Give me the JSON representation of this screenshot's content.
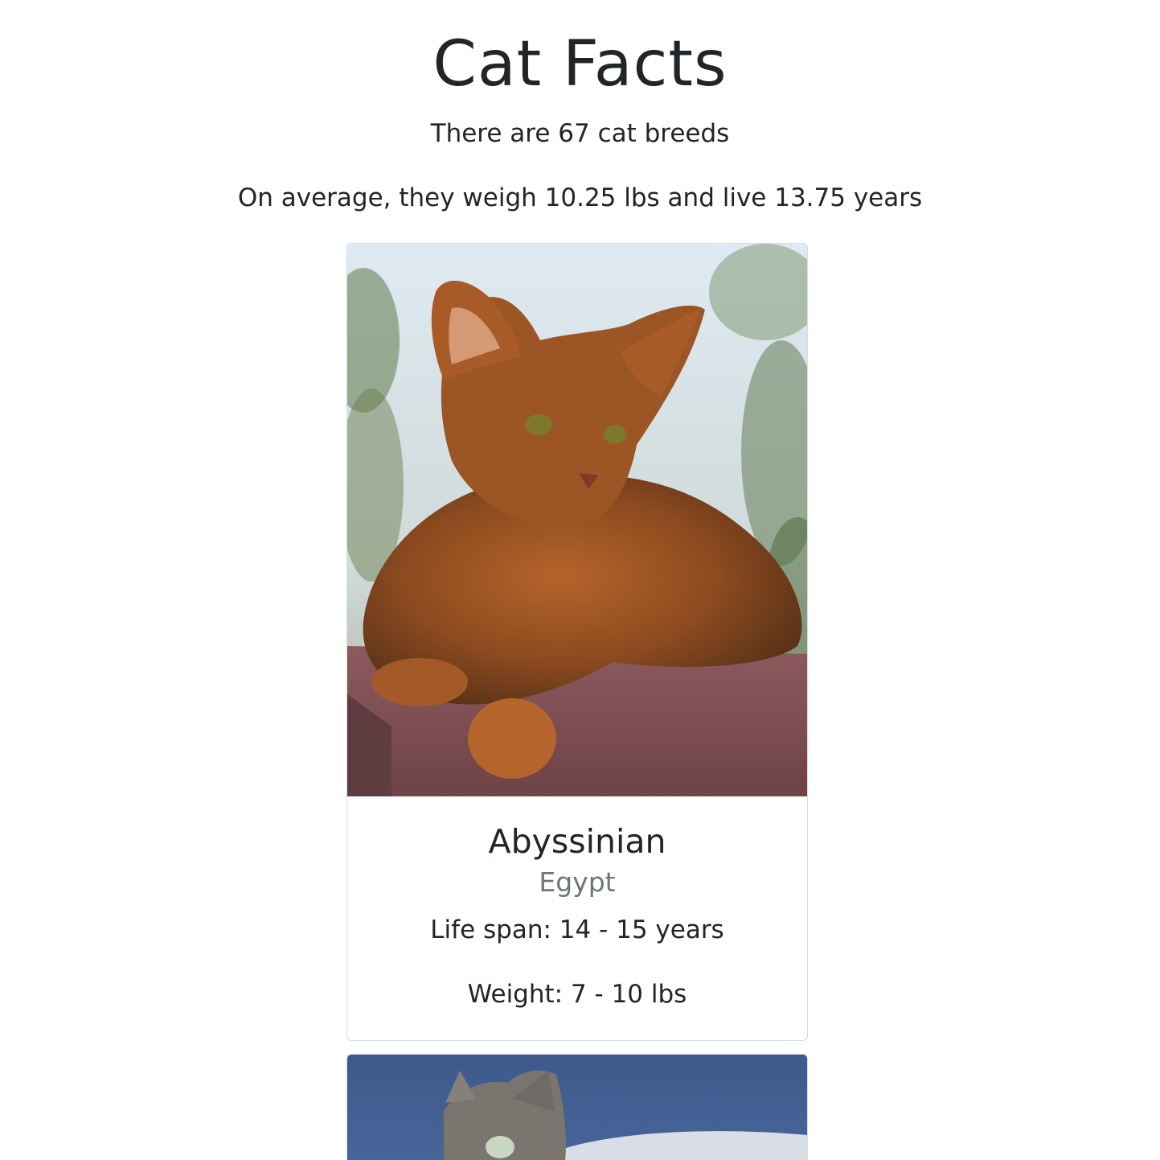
{
  "page": {
    "title": "Cat Facts",
    "breed_count_text": "There are 67 cat breeds",
    "average_text": "On average, they weigh 10.25 lbs and live 13.75 years"
  },
  "breeds": [
    {
      "name": "Abyssinian",
      "origin": "Egypt",
      "life_span": "Life span: 14 - 15 years",
      "weight": "Weight: 7 - 10 lbs",
      "photo_alt": "Abyssinian cat lying on a red brick ledge"
    },
    {
      "photo_alt": "Tabby kitten in front of a blue sky"
    }
  ],
  "colors": {
    "text": "#212529",
    "muted": "#6c757d",
    "card_border": "#d9dbde"
  }
}
